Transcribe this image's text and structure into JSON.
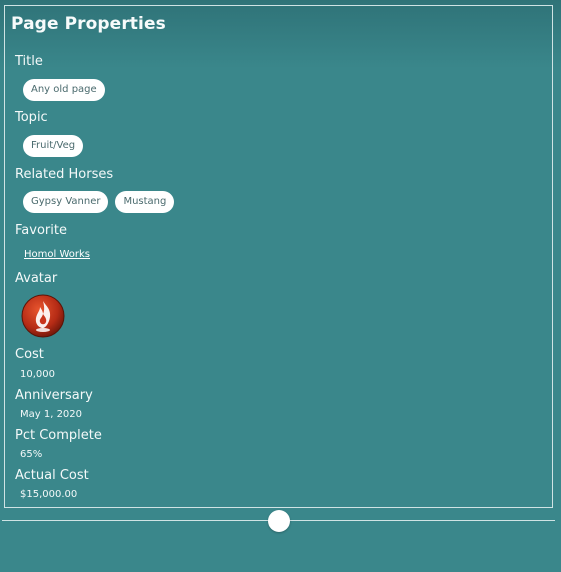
{
  "panel": {
    "title": "Page Properties"
  },
  "fields": {
    "title": {
      "label": "Title",
      "chips": [
        "Any old page"
      ]
    },
    "topic": {
      "label": "Topic",
      "chips": [
        "Fruit/Veg"
      ]
    },
    "related_horses": {
      "label": "Related Horses",
      "chips": [
        "Gypsy Vanner",
        "Mustang"
      ]
    },
    "favorite": {
      "label": "Favorite",
      "value": "Homol Works"
    },
    "avatar": {
      "label": "Avatar",
      "icon": "flame-icon"
    },
    "cost": {
      "label": "Cost",
      "value": "10,000"
    },
    "anniversary": {
      "label": "Anniversary",
      "value": "May 1, 2020"
    },
    "pct_complete": {
      "label": "Pct Complete",
      "value": "65%"
    },
    "actual_cost": {
      "label": "Actual Cost",
      "value": "$15,000.00"
    }
  },
  "slider": {
    "position": 0.5
  },
  "colors": {
    "background": "#3a878b",
    "panel_border": "#cfe3e4",
    "chip_bg": "#ffffff",
    "chip_text": "#4a6a6d",
    "avatar_red": "#c8341c"
  }
}
